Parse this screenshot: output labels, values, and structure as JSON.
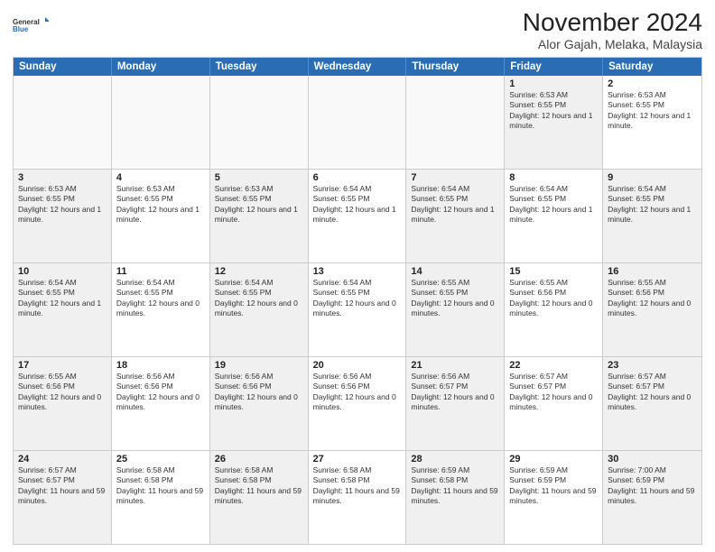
{
  "header": {
    "logo_line1": "General",
    "logo_line2": "Blue",
    "title": "November 2024",
    "subtitle": "Alor Gajah, Melaka, Malaysia"
  },
  "calendar": {
    "days_of_week": [
      "Sunday",
      "Monday",
      "Tuesday",
      "Wednesday",
      "Thursday",
      "Friday",
      "Saturday"
    ],
    "rows": [
      [
        {
          "day": "",
          "info": "",
          "empty": true
        },
        {
          "day": "",
          "info": "",
          "empty": true
        },
        {
          "day": "",
          "info": "",
          "empty": true
        },
        {
          "day": "",
          "info": "",
          "empty": true
        },
        {
          "day": "",
          "info": "",
          "empty": true
        },
        {
          "day": "1",
          "info": "Sunrise: 6:53 AM\nSunset: 6:55 PM\nDaylight: 12 hours and 1 minute.",
          "shaded": true
        },
        {
          "day": "2",
          "info": "Sunrise: 6:53 AM\nSunset: 6:55 PM\nDaylight: 12 hours and 1 minute.",
          "shaded": false
        }
      ],
      [
        {
          "day": "3",
          "info": "Sunrise: 6:53 AM\nSunset: 6:55 PM\nDaylight: 12 hours and 1 minute.",
          "shaded": true
        },
        {
          "day": "4",
          "info": "Sunrise: 6:53 AM\nSunset: 6:55 PM\nDaylight: 12 hours and 1 minute.",
          "shaded": false
        },
        {
          "day": "5",
          "info": "Sunrise: 6:53 AM\nSunset: 6:55 PM\nDaylight: 12 hours and 1 minute.",
          "shaded": true
        },
        {
          "day": "6",
          "info": "Sunrise: 6:54 AM\nSunset: 6:55 PM\nDaylight: 12 hours and 1 minute.",
          "shaded": false
        },
        {
          "day": "7",
          "info": "Sunrise: 6:54 AM\nSunset: 6:55 PM\nDaylight: 12 hours and 1 minute.",
          "shaded": true
        },
        {
          "day": "8",
          "info": "Sunrise: 6:54 AM\nSunset: 6:55 PM\nDaylight: 12 hours and 1 minute.",
          "shaded": false
        },
        {
          "day": "9",
          "info": "Sunrise: 6:54 AM\nSunset: 6:55 PM\nDaylight: 12 hours and 1 minute.",
          "shaded": true
        }
      ],
      [
        {
          "day": "10",
          "info": "Sunrise: 6:54 AM\nSunset: 6:55 PM\nDaylight: 12 hours and 1 minute.",
          "shaded": true
        },
        {
          "day": "11",
          "info": "Sunrise: 6:54 AM\nSunset: 6:55 PM\nDaylight: 12 hours and 0 minutes.",
          "shaded": false
        },
        {
          "day": "12",
          "info": "Sunrise: 6:54 AM\nSunset: 6:55 PM\nDaylight: 12 hours and 0 minutes.",
          "shaded": true
        },
        {
          "day": "13",
          "info": "Sunrise: 6:54 AM\nSunset: 6:55 PM\nDaylight: 12 hours and 0 minutes.",
          "shaded": false
        },
        {
          "day": "14",
          "info": "Sunrise: 6:55 AM\nSunset: 6:55 PM\nDaylight: 12 hours and 0 minutes.",
          "shaded": true
        },
        {
          "day": "15",
          "info": "Sunrise: 6:55 AM\nSunset: 6:56 PM\nDaylight: 12 hours and 0 minutes.",
          "shaded": false
        },
        {
          "day": "16",
          "info": "Sunrise: 6:55 AM\nSunset: 6:56 PM\nDaylight: 12 hours and 0 minutes.",
          "shaded": true
        }
      ],
      [
        {
          "day": "17",
          "info": "Sunrise: 6:55 AM\nSunset: 6:56 PM\nDaylight: 12 hours and 0 minutes.",
          "shaded": true
        },
        {
          "day": "18",
          "info": "Sunrise: 6:56 AM\nSunset: 6:56 PM\nDaylight: 12 hours and 0 minutes.",
          "shaded": false
        },
        {
          "day": "19",
          "info": "Sunrise: 6:56 AM\nSunset: 6:56 PM\nDaylight: 12 hours and 0 minutes.",
          "shaded": true
        },
        {
          "day": "20",
          "info": "Sunrise: 6:56 AM\nSunset: 6:56 PM\nDaylight: 12 hours and 0 minutes.",
          "shaded": false
        },
        {
          "day": "21",
          "info": "Sunrise: 6:56 AM\nSunset: 6:57 PM\nDaylight: 12 hours and 0 minutes.",
          "shaded": true
        },
        {
          "day": "22",
          "info": "Sunrise: 6:57 AM\nSunset: 6:57 PM\nDaylight: 12 hours and 0 minutes.",
          "shaded": false
        },
        {
          "day": "23",
          "info": "Sunrise: 6:57 AM\nSunset: 6:57 PM\nDaylight: 12 hours and 0 minutes.",
          "shaded": true
        }
      ],
      [
        {
          "day": "24",
          "info": "Sunrise: 6:57 AM\nSunset: 6:57 PM\nDaylight: 11 hours and 59 minutes.",
          "shaded": true
        },
        {
          "day": "25",
          "info": "Sunrise: 6:58 AM\nSunset: 6:58 PM\nDaylight: 11 hours and 59 minutes.",
          "shaded": false
        },
        {
          "day": "26",
          "info": "Sunrise: 6:58 AM\nSunset: 6:58 PM\nDaylight: 11 hours and 59 minutes.",
          "shaded": true
        },
        {
          "day": "27",
          "info": "Sunrise: 6:58 AM\nSunset: 6:58 PM\nDaylight: 11 hours and 59 minutes.",
          "shaded": false
        },
        {
          "day": "28",
          "info": "Sunrise: 6:59 AM\nSunset: 6:58 PM\nDaylight: 11 hours and 59 minutes.",
          "shaded": true
        },
        {
          "day": "29",
          "info": "Sunrise: 6:59 AM\nSunset: 6:59 PM\nDaylight: 11 hours and 59 minutes.",
          "shaded": false
        },
        {
          "day": "30",
          "info": "Sunrise: 7:00 AM\nSunset: 6:59 PM\nDaylight: 11 hours and 59 minutes.",
          "shaded": true
        }
      ]
    ]
  }
}
